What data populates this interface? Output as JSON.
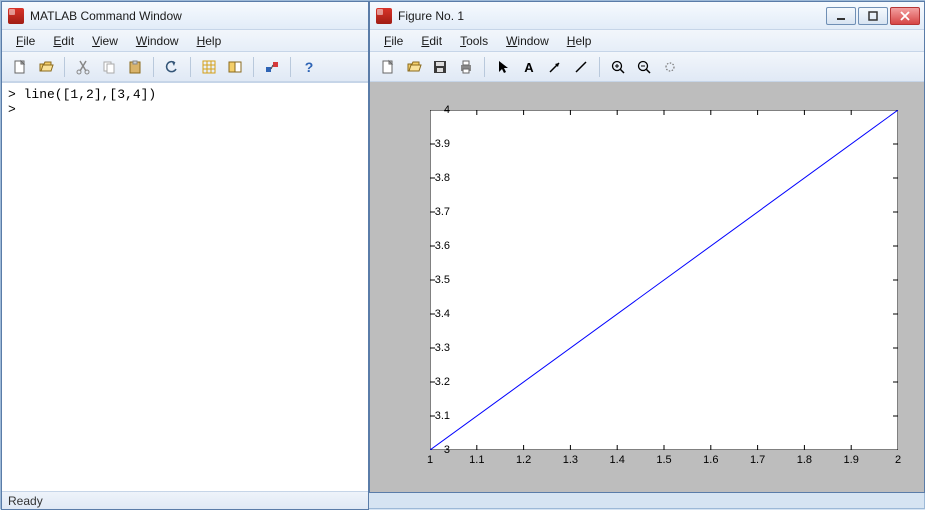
{
  "cmdwin": {
    "title": "MATLAB Command Window",
    "menus": {
      "file": "File",
      "edit": "Edit",
      "view": "View",
      "window": "Window",
      "help": "Help"
    },
    "lines": {
      "l0": "> line([1,2],[3,4])",
      "l1": ">"
    },
    "status": "Ready"
  },
  "figwin": {
    "title": "Figure No. 1",
    "menus": {
      "file": "File",
      "edit": "Edit",
      "tools": "Tools",
      "window": "Window",
      "help": "Help"
    }
  },
  "chart_data": {
    "type": "line",
    "x": [
      1,
      2
    ],
    "y": [
      3,
      4
    ],
    "xlim": [
      1,
      2
    ],
    "ylim": [
      3,
      4
    ],
    "xticks": [
      1,
      1.1,
      1.2,
      1.3,
      1.4,
      1.5,
      1.6,
      1.7,
      1.8,
      1.9,
      2
    ],
    "yticks": [
      3,
      3.1,
      3.2,
      3.3,
      3.4,
      3.5,
      3.6,
      3.7,
      3.8,
      3.9,
      4
    ],
    "line_color": "#0000ff",
    "title": "",
    "xlabel": "",
    "ylabel": ""
  }
}
